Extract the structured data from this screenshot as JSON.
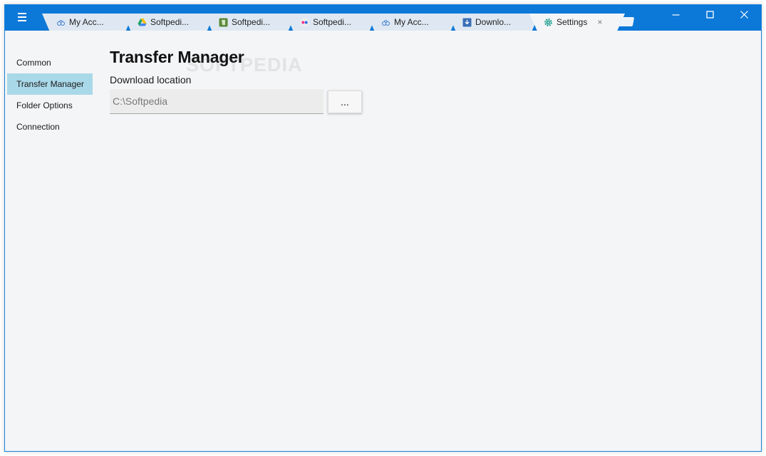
{
  "tabs": [
    {
      "label": "My Acc...",
      "icon": "cloud-sync-icon",
      "active": false
    },
    {
      "label": "Softpedi...",
      "icon": "google-drive-icon",
      "active": false
    },
    {
      "label": "Softpedi...",
      "icon": "evernote-icon",
      "active": false
    },
    {
      "label": "Softpedi...",
      "icon": "flickr-icon",
      "active": false
    },
    {
      "label": "My Acc...",
      "icon": "cloud-sync-icon",
      "active": false
    },
    {
      "label": "Downlo...",
      "icon": "download-box-icon",
      "active": false
    },
    {
      "label": "Settings",
      "icon": "gear-icon",
      "active": true,
      "close": "×"
    }
  ],
  "sidebar": {
    "items": [
      {
        "label": "Common"
      },
      {
        "label": "Transfer Manager",
        "active": true
      },
      {
        "label": "Folder Options"
      },
      {
        "label": "Connection"
      }
    ]
  },
  "main": {
    "title": "Transfer Manager",
    "download_location_label": "Download location",
    "download_path": "C:\\Softpedia",
    "browse_label": "..."
  },
  "watermark": "SOFTPEDIA",
  "colors": {
    "titlebar": "#0c78d8",
    "sidebar_active": "#a9d8e8",
    "background": "#f4f5f7"
  }
}
